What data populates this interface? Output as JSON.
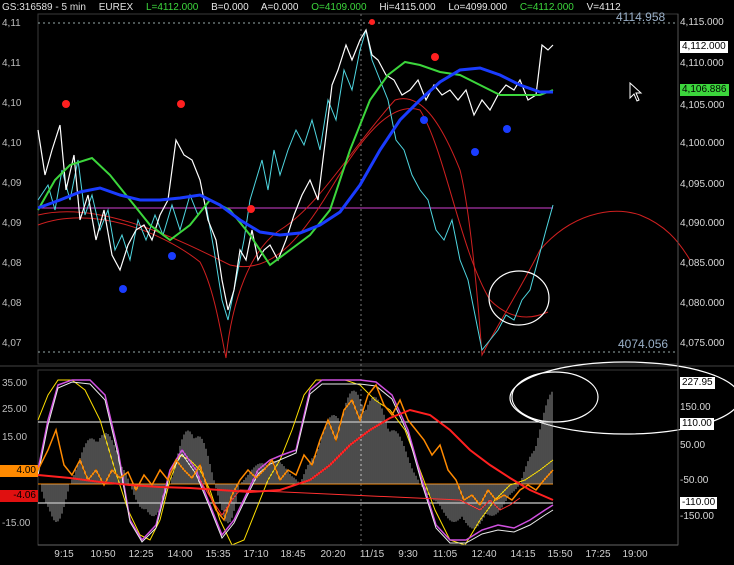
{
  "header": {
    "symbol": "GS:316589 - 5 min",
    "exchange": "EUREX",
    "last": "L=4112.000",
    "bid": "B=0.000",
    "ask": "A=0.000",
    "open": "O=4109.000",
    "high": "Hi=4115.000",
    "low": "Lo=4099.000",
    "close": "C=4112.000",
    "volume": "V=4112"
  },
  "price_panel": {
    "top_level_label": "4114.958",
    "bottom_level_label": "4074.056",
    "right_axis": [
      {
        "label": "4,115.000",
        "value": 4115
      },
      {
        "label": "4,110.000",
        "value": 4110
      },
      {
        "label": "4,105.000",
        "value": 4105
      },
      {
        "label": "4,100.000",
        "value": 4100
      },
      {
        "label": "4,095.000",
        "value": 4095
      },
      {
        "label": "4,090.000",
        "value": 4090
      },
      {
        "label": "4,085.000",
        "value": 4085
      },
      {
        "label": "4,080.000",
        "value": 4080
      },
      {
        "label": "4,075.000",
        "value": 4075
      }
    ],
    "left_axis": [
      "4,11",
      "4,11",
      "4,10",
      "4,10",
      "4,09",
      "4,09",
      "4,08",
      "4,08",
      "4,07"
    ],
    "last_price_tag": "4,112.000",
    "ma_price_tag": "4,106.886"
  },
  "oscillator_panel": {
    "left_axis": [
      "35.00",
      "25.00",
      "15.00",
      "-15.00"
    ],
    "tag_positive": "4.00",
    "tag_negative": "-4.06",
    "right_axis": [
      "227.95",
      "150.00",
      "110.00",
      "50.00",
      "-50.00",
      "-110.00",
      "-150.00"
    ]
  },
  "time_axis": [
    "9:15",
    "10:50",
    "12:25",
    "14:00",
    "15:35",
    "17:10",
    "18:45",
    "20:20",
    "11/15",
    "9:30",
    "11:05",
    "12:40",
    "14:15",
    "15:50",
    "17:25",
    "19:00"
  ],
  "colors": {
    "background": "#000000",
    "price_white": "#ffffff",
    "price_cyan": "#4fd6e0",
    "ma_blue": "#1a3cff",
    "ma_green": "#3cd63c",
    "band_red": "#d02020",
    "dot_red": "#ff2020",
    "dot_blue": "#1a3cff",
    "level_magenta": "#d040d0",
    "osc_orange": "#ff8a00",
    "osc_yellow": "#ffe000",
    "osc_magenta": "#d050e0"
  }
}
